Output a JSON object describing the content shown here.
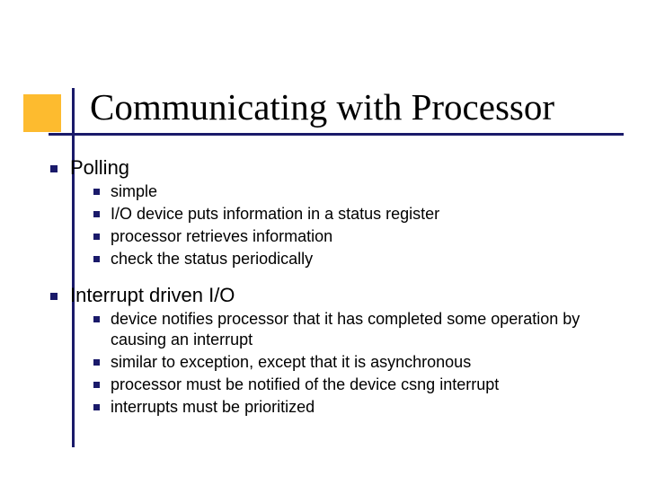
{
  "title": "Communicating with Processor",
  "sections": [
    {
      "heading": "Polling",
      "items": [
        "simple",
        "I/O device puts information in a status register",
        "processor retrieves information",
        "check the status periodically"
      ]
    },
    {
      "heading": "Interrupt driven I/O",
      "items": [
        "device notifies processor that it has completed some operation by causing an interrupt",
        "similar to exception, except that it is asynchronous",
        "processor must be notified of the device csng interrupt",
        "interrupts must be prioritized"
      ]
    }
  ]
}
